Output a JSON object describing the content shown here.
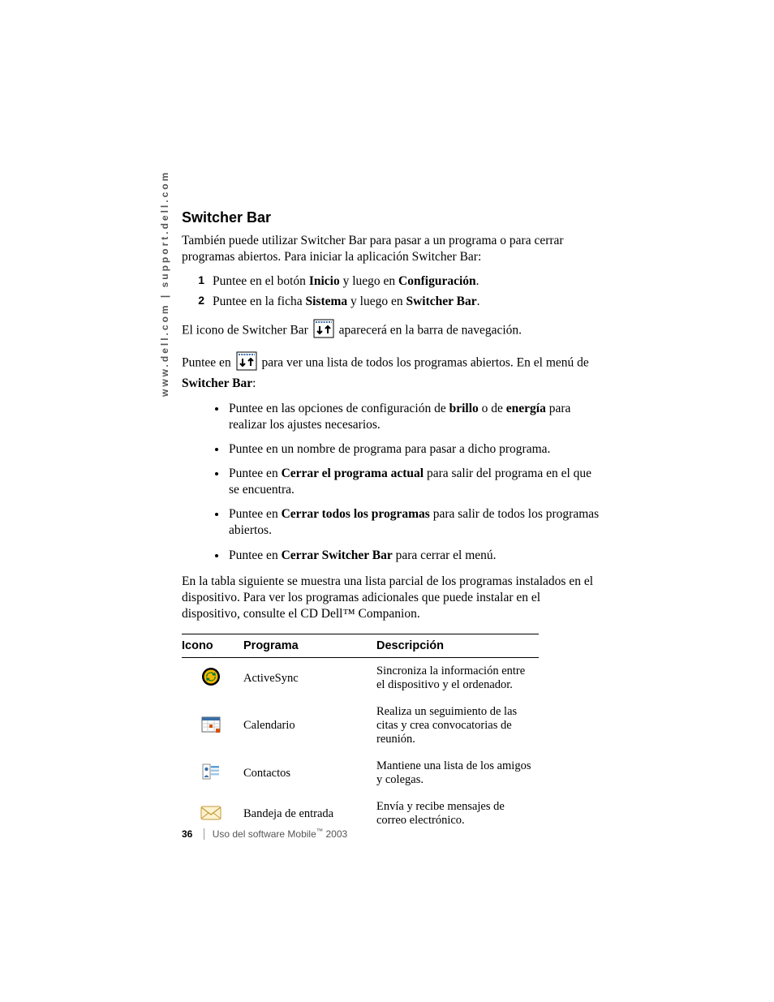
{
  "side_label": "www.dell.com | support.dell.com",
  "title": "Switcher Bar",
  "intro": "También puede utilizar Switcher Bar para pasar a un programa o para cerrar programas abiertos. Para iniciar la aplicación Switcher Bar:",
  "steps": [
    {
      "n": "1",
      "pre": "Puntee en el botón ",
      "b1": "Inicio",
      "mid": " y luego en ",
      "b2": "Configuración",
      "post": "."
    },
    {
      "n": "2",
      "pre": "Puntee en la ficha ",
      "b1": "Sistema",
      "mid": " y luego en ",
      "b2": "Switcher Bar",
      "post": "."
    }
  ],
  "icon_line_pre": "El icono de Switcher Bar ",
  "icon_line_post": " aparecerá en la barra de navegación.",
  "tap_line_pre": "Puntee en ",
  "tap_line_mid": " para ver una lista de todos los programas abiertos. En el menú de ",
  "tap_line_bold": "Switcher Bar",
  "tap_line_post": ":",
  "bullets": [
    {
      "pre": "Puntee en las opciones de configuración de ",
      "b1": "brillo",
      "mid": " o de ",
      "b2": "energía",
      "post": " para realizar los ajustes necesarios."
    },
    {
      "pre": "Puntee en un nombre de programa para pasar a dicho programa.",
      "b1": "",
      "mid": "",
      "b2": "",
      "post": ""
    },
    {
      "pre": "Puntee en ",
      "b1": "Cerrar el programa actual",
      "mid": "",
      "b2": "",
      "post": " para salir del programa en el que se encuentra."
    },
    {
      "pre": "Puntee en ",
      "b1": "Cerrar todos los programas",
      "mid": "",
      "b2": "",
      "post": " para salir de todos los programas abiertos."
    },
    {
      "pre": "Puntee en ",
      "b1": "Cerrar Switcher Bar",
      "mid": "",
      "b2": "",
      "post": " para cerrar el menú."
    }
  ],
  "table_intro": "En la tabla siguiente se muestra una lista parcial de los programas instalados en el dispositivo. Para ver los programas adicionales que puede instalar en el dispositivo, consulte el CD Dell™ Companion.",
  "table": {
    "headers": {
      "icon": "Icono",
      "program": "Programa",
      "desc": "Descripción"
    },
    "rows": [
      {
        "program": "ActiveSync",
        "desc": "Sincroniza la información entre el dispositivo y el ordenador.",
        "icon_name": "activesync-icon"
      },
      {
        "program": "Calendario",
        "desc": "Realiza un seguimiento de las citas y crea convocatorias de reunión.",
        "icon_name": "calendar-icon"
      },
      {
        "program": "Contactos",
        "desc": "Mantiene una lista de los amigos y colegas.",
        "icon_name": "contacts-icon"
      },
      {
        "program": "Bandeja de entrada",
        "desc": "Envía y recibe mensajes de correo electrónico.",
        "icon_name": "inbox-icon"
      }
    ]
  },
  "footer": {
    "page": "36",
    "text_pre": "Uso del software Mobile",
    "tm": "™",
    "text_post": " 2003"
  }
}
